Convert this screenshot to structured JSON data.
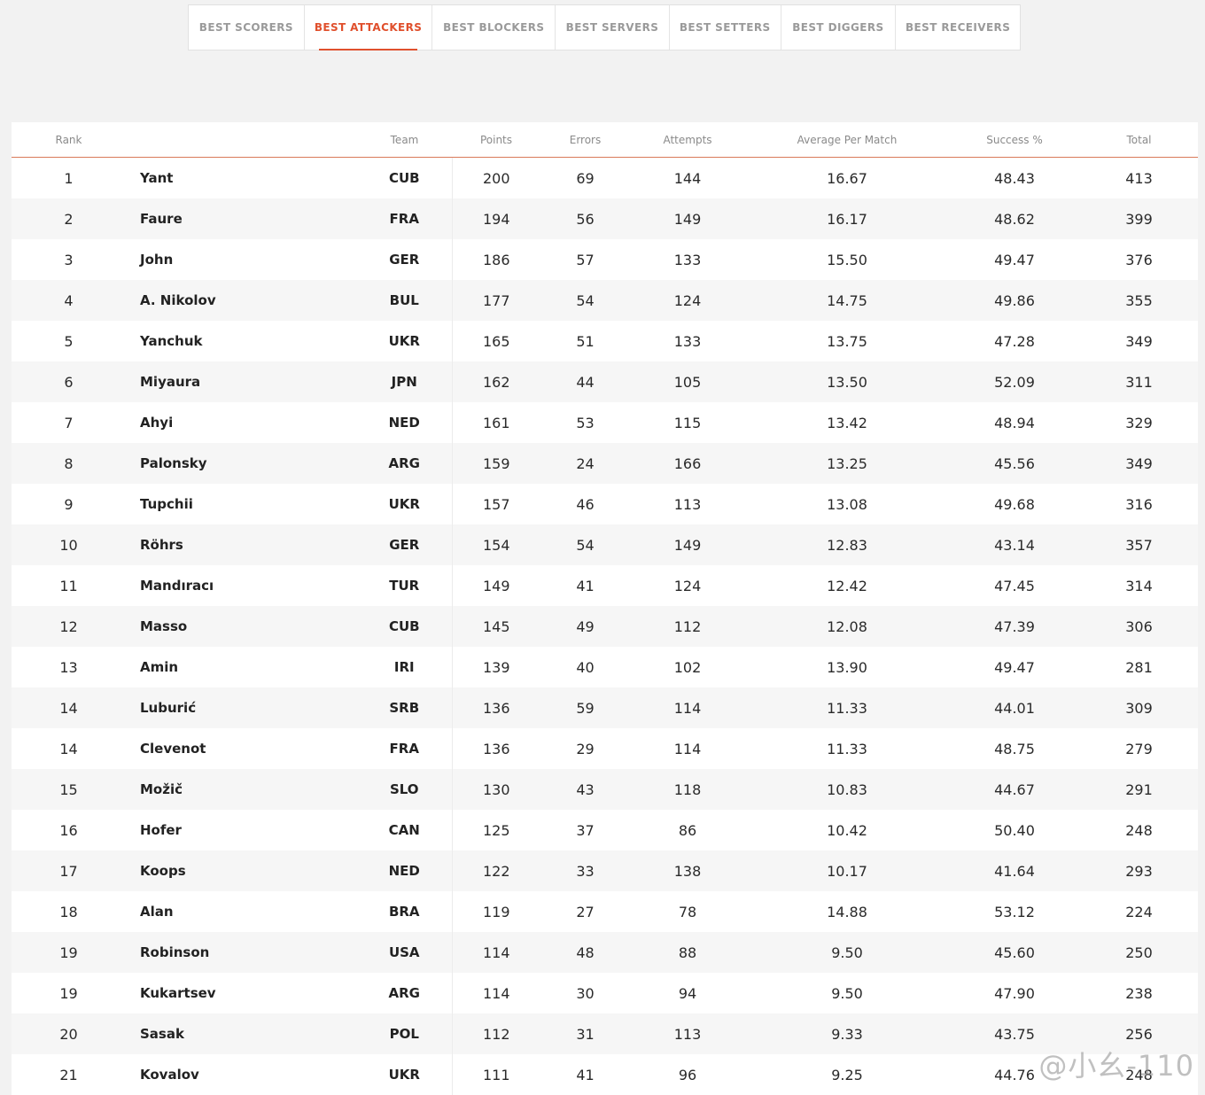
{
  "tabs": [
    {
      "label": "BEST SCORERS",
      "active": false
    },
    {
      "label": "BEST ATTACKERS",
      "active": true
    },
    {
      "label": "BEST BLOCKERS",
      "active": false
    },
    {
      "label": "BEST SERVERS",
      "active": false
    },
    {
      "label": "BEST SETTERS",
      "active": false
    },
    {
      "label": "BEST DIGGERS",
      "active": false
    },
    {
      "label": "BEST RECEIVERS",
      "active": false
    }
  ],
  "accent_color": "#e0502d",
  "table": {
    "headers": {
      "rank": "Rank",
      "player": "",
      "team": "Team",
      "points": "Points",
      "errors": "Errors",
      "attempts": "Attempts",
      "average": "Average Per Match",
      "success": "Success %",
      "total": "Total"
    },
    "rows": [
      {
        "rank": "1",
        "player": "Yant",
        "team": "CUB",
        "points": "200",
        "errors": "69",
        "attempts": "144",
        "average": "16.67",
        "success": "48.43",
        "total": "413"
      },
      {
        "rank": "2",
        "player": "Faure",
        "team": "FRA",
        "points": "194",
        "errors": "56",
        "attempts": "149",
        "average": "16.17",
        "success": "48.62",
        "total": "399"
      },
      {
        "rank": "3",
        "player": "John",
        "team": "GER",
        "points": "186",
        "errors": "57",
        "attempts": "133",
        "average": "15.50",
        "success": "49.47",
        "total": "376"
      },
      {
        "rank": "4",
        "player": "A. Nikolov",
        "team": "BUL",
        "points": "177",
        "errors": "54",
        "attempts": "124",
        "average": "14.75",
        "success": "49.86",
        "total": "355"
      },
      {
        "rank": "5",
        "player": "Yanchuk",
        "team": "UKR",
        "points": "165",
        "errors": "51",
        "attempts": "133",
        "average": "13.75",
        "success": "47.28",
        "total": "349"
      },
      {
        "rank": "6",
        "player": "Miyaura",
        "team": "JPN",
        "points": "162",
        "errors": "44",
        "attempts": "105",
        "average": "13.50",
        "success": "52.09",
        "total": "311"
      },
      {
        "rank": "7",
        "player": "Ahyi",
        "team": "NED",
        "points": "161",
        "errors": "53",
        "attempts": "115",
        "average": "13.42",
        "success": "48.94",
        "total": "329"
      },
      {
        "rank": "8",
        "player": "Palonsky",
        "team": "ARG",
        "points": "159",
        "errors": "24",
        "attempts": "166",
        "average": "13.25",
        "success": "45.56",
        "total": "349"
      },
      {
        "rank": "9",
        "player": "Tupchii",
        "team": "UKR",
        "points": "157",
        "errors": "46",
        "attempts": "113",
        "average": "13.08",
        "success": "49.68",
        "total": "316"
      },
      {
        "rank": "10",
        "player": "Röhrs",
        "team": "GER",
        "points": "154",
        "errors": "54",
        "attempts": "149",
        "average": "12.83",
        "success": "43.14",
        "total": "357"
      },
      {
        "rank": "11",
        "player": "Mandıracı",
        "team": "TUR",
        "points": "149",
        "errors": "41",
        "attempts": "124",
        "average": "12.42",
        "success": "47.45",
        "total": "314"
      },
      {
        "rank": "12",
        "player": "Masso",
        "team": "CUB",
        "points": "145",
        "errors": "49",
        "attempts": "112",
        "average": "12.08",
        "success": "47.39",
        "total": "306"
      },
      {
        "rank": "13",
        "player": "Amin",
        "team": "IRI",
        "points": "139",
        "errors": "40",
        "attempts": "102",
        "average": "13.90",
        "success": "49.47",
        "total": "281"
      },
      {
        "rank": "14",
        "player": "Luburić",
        "team": "SRB",
        "points": "136",
        "errors": "59",
        "attempts": "114",
        "average": "11.33",
        "success": "44.01",
        "total": "309"
      },
      {
        "rank": "14",
        "player": "Clevenot",
        "team": "FRA",
        "points": "136",
        "errors": "29",
        "attempts": "114",
        "average": "11.33",
        "success": "48.75",
        "total": "279"
      },
      {
        "rank": "15",
        "player": "Možič",
        "team": "SLO",
        "points": "130",
        "errors": "43",
        "attempts": "118",
        "average": "10.83",
        "success": "44.67",
        "total": "291"
      },
      {
        "rank": "16",
        "player": "Hofer",
        "team": "CAN",
        "points": "125",
        "errors": "37",
        "attempts": "86",
        "average": "10.42",
        "success": "50.40",
        "total": "248"
      },
      {
        "rank": "17",
        "player": "Koops",
        "team": "NED",
        "points": "122",
        "errors": "33",
        "attempts": "138",
        "average": "10.17",
        "success": "41.64",
        "total": "293"
      },
      {
        "rank": "18",
        "player": "Alan",
        "team": "BRA",
        "points": "119",
        "errors": "27",
        "attempts": "78",
        "average": "14.88",
        "success": "53.12",
        "total": "224"
      },
      {
        "rank": "19",
        "player": "Robinson",
        "team": "USA",
        "points": "114",
        "errors": "48",
        "attempts": "88",
        "average": "9.50",
        "success": "45.60",
        "total": "250"
      },
      {
        "rank": "19",
        "player": "Kukartsev",
        "team": "ARG",
        "points": "114",
        "errors": "30",
        "attempts": "94",
        "average": "9.50",
        "success": "47.90",
        "total": "238"
      },
      {
        "rank": "20",
        "player": "Sasak",
        "team": "POL",
        "points": "112",
        "errors": "31",
        "attempts": "113",
        "average": "9.33",
        "success": "43.75",
        "total": "256"
      },
      {
        "rank": "21",
        "player": "Kovalov",
        "team": "UKR",
        "points": "111",
        "errors": "41",
        "attempts": "96",
        "average": "9.25",
        "success": "44.76",
        "total": "248"
      }
    ]
  },
  "watermark": "@小幺-110"
}
